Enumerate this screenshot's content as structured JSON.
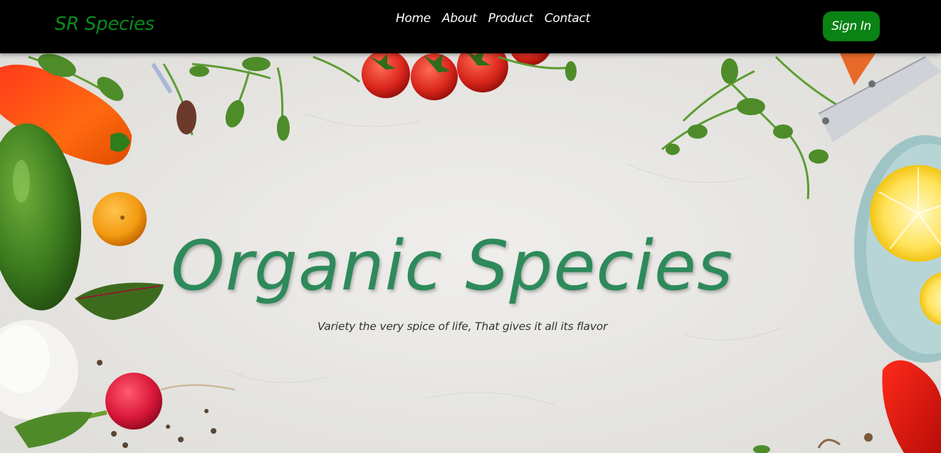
{
  "brand": {
    "name": "SR Species",
    "color": "#0a8a1e"
  },
  "nav": {
    "items": [
      {
        "label": "Home"
      },
      {
        "label": "About"
      },
      {
        "label": "Product"
      },
      {
        "label": "Contact"
      }
    ]
  },
  "signin": {
    "label": "Sign In",
    "color": "#0a8214"
  },
  "hero": {
    "title": "Organic Species",
    "subtitle": "Variety the very spice of life, That gives it all its flavor",
    "title_color": "#2e8a5a",
    "background_color": "#e9e8e5"
  }
}
